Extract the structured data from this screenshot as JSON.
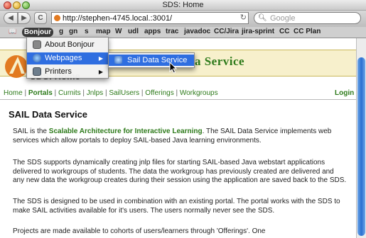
{
  "window": {
    "title": "SDS: Home"
  },
  "toolbar": {
    "back_icon": "back-arrow-icon",
    "forward_icon": "forward-arrow-icon",
    "reload_glyph": "C",
    "url": "http://stephen-4745.local.:3001/",
    "search_placeholder": "Google"
  },
  "bookmarks": {
    "active": "Bonjour ▾",
    "items": [
      "g",
      "gn",
      "s",
      "map",
      "W",
      "udl",
      "apps",
      "trac",
      "javadoc",
      "CC/Jira",
      "jira-sprint",
      "CC",
      "CC Plan"
    ]
  },
  "menus": {
    "bonjour": [
      {
        "label": "About Bonjour",
        "icon": "bonjour-icon"
      },
      {
        "label": "Webpages",
        "icon": "globe-icon",
        "submenu": true,
        "highlighted": true
      },
      {
        "label": "Printers",
        "icon": "printer-icon",
        "submenu": true
      }
    ],
    "webpages_submenu": [
      {
        "label": "Sail Data Service",
        "icon": "webpage-icon",
        "highlighted": true
      }
    ]
  },
  "page": {
    "banner_title": "Data Service",
    "home_heading": "SDS: Home",
    "nav": [
      {
        "label": "Home"
      },
      {
        "label": "Portals",
        "current": true
      },
      {
        "label": "Curnits"
      },
      {
        "label": "Jnlps"
      },
      {
        "label": "SailUsers"
      },
      {
        "label": "Offerings"
      },
      {
        "label": "Workgroups"
      }
    ],
    "login": "Login",
    "heading": "SAIL Data Service",
    "p1_pre": "SAIL is the ",
    "p1_link": "Scalable Architecture for Interactive Learning",
    "p1_post": ". The SAIL Data Service implements web services which allow portals to deploy SAIL-based Java learning environments.",
    "p2": "The SDS supports dynamically creating jnlp files for starting SAIL-based Java webstart applications delivered to workgroups of students. The data the workgroup has previously created are delivered and any new data the workgroup creates during their session using the application are saved back to the SDS.",
    "p3": "The SDS is designed to be used in combination with an existing portal. The portal works with the SDS to make SAIL activities available for it's users. The users normally never see the SDS.",
    "p4": "Projects are made available to cohorts of users/learners through 'Offerings'. One"
  }
}
